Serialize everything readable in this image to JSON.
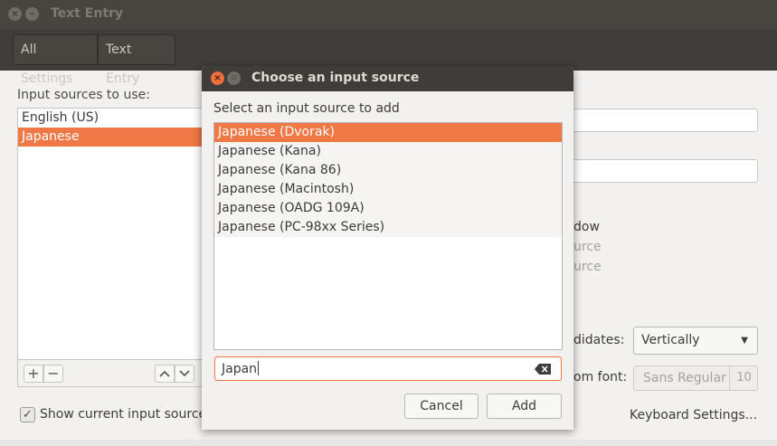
{
  "main": {
    "title": "Text Entry",
    "breadcrumbs": [
      "All Settings",
      "Text Entry"
    ],
    "sources_label": "Input sources to use:",
    "sources": [
      {
        "label": "English (US)",
        "selected": false
      },
      {
        "label": "Japanese",
        "selected": true
      }
    ],
    "tools": {
      "add": "+",
      "remove": "−",
      "up": "⌃",
      "down": "⌄"
    },
    "show_current_label": "Show current input source",
    "show_current_checked": true,
    "right_fragments": {
      "window": "dow",
      "src1": "urce",
      "src2": "urce"
    },
    "candidates_label": "didates:",
    "orientation_value": "Vertically",
    "font_label": "om font:",
    "font_name": "Sans Regular",
    "font_size": "10",
    "keyboard_settings": "Keyboard Settings..."
  },
  "dialog": {
    "title": "Choose an input source",
    "heading": "Select an input source to add",
    "items": [
      {
        "label": "Japanese (Dvorak)",
        "selected": true
      },
      {
        "label": "Japanese (Kana)",
        "selected": false
      },
      {
        "label": "Japanese (Kana 86)",
        "selected": false
      },
      {
        "label": "Japanese (Macintosh)",
        "selected": false
      },
      {
        "label": "Japanese (OADG 109A)",
        "selected": false
      },
      {
        "label": "Japanese (PC-98xx Series)",
        "selected": false
      }
    ],
    "search_value": "Japan",
    "cancel_label": "Cancel",
    "add_label": "Add"
  },
  "colors": {
    "accent": "#f07746",
    "titlebar": "#3e3d39",
    "background": "#f2f1f0"
  }
}
